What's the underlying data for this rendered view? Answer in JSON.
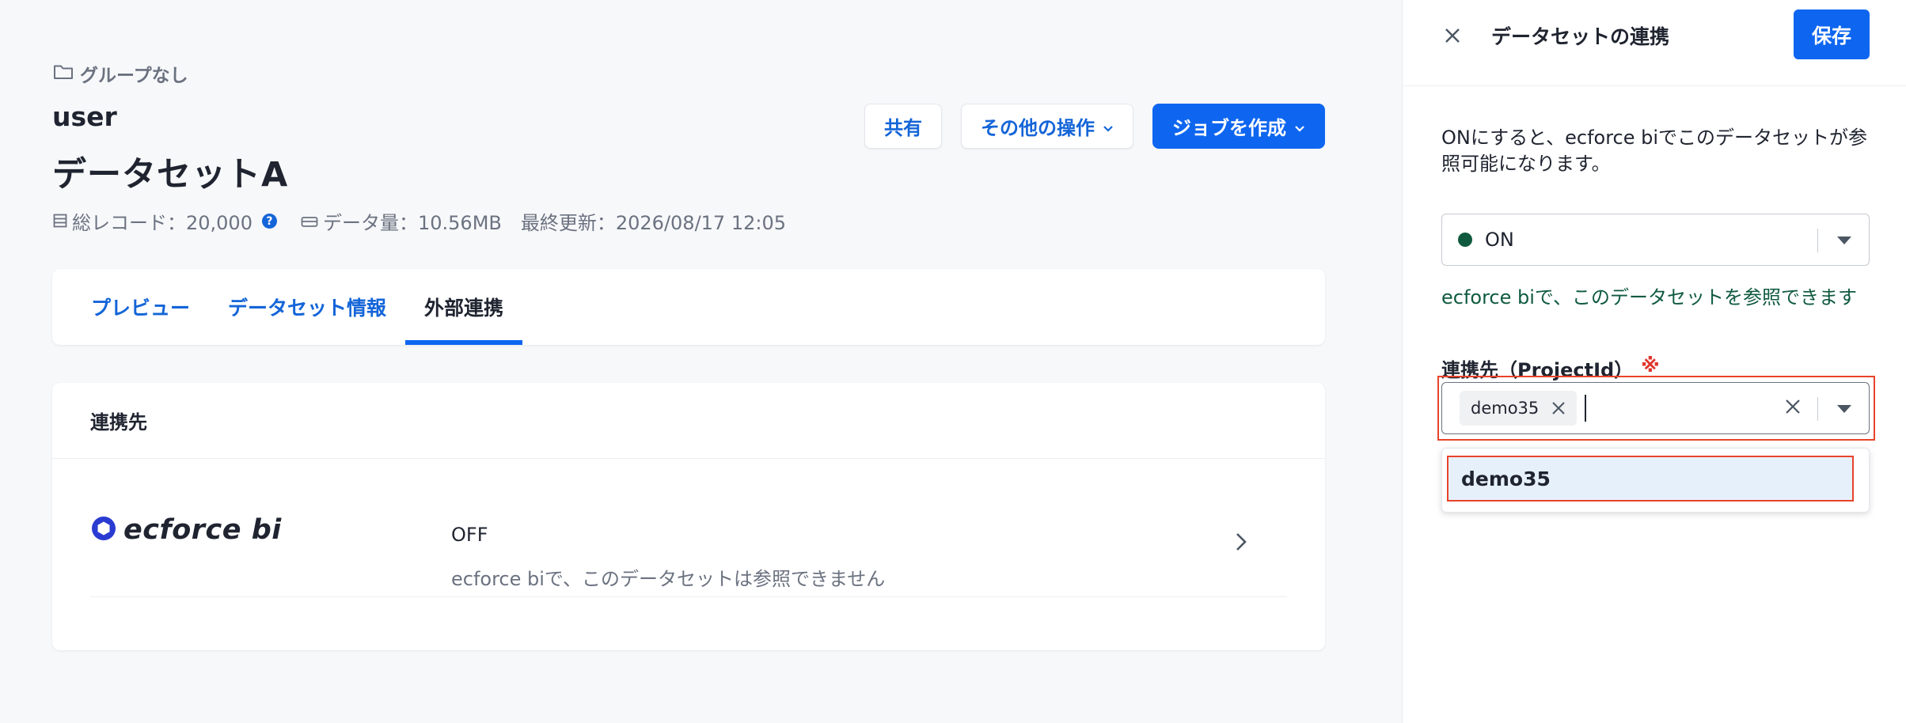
{
  "header": {
    "group_label": "グループなし",
    "owner": "user",
    "dataset_title": "データセットA",
    "total_records_label": "総レコード：20,000",
    "help_icon_glyph": "?",
    "data_size_label": "データ量：10.56MB",
    "last_updated_label": "最終更新：2026/08/17 12:05"
  },
  "actions": {
    "share_label": "共有",
    "other_actions_label": "その他の操作",
    "create_job_label": "ジョブを作成"
  },
  "tabs": [
    {
      "label": "プレビュー",
      "active": false
    },
    {
      "label": "データセット情報",
      "active": false
    },
    {
      "label": "外部連携",
      "active": true
    }
  ],
  "link_card": {
    "header": "連携先",
    "service_name": "ecforce bi",
    "status": "OFF",
    "status_description": "ecforce biで、このデータセットは参照できません"
  },
  "panel": {
    "title": "データセットの連携",
    "save_label": "保存",
    "description": "ONにすると、ecforce biでこのデータセットが参照可能になります。",
    "toggle_select_value": "ON",
    "toggle_help": "ecforce biで、このデータセットを参照できます",
    "field_label": "連携先（ProjectId）",
    "required_mark": "※",
    "selected_chip": "demo35",
    "search_value": "",
    "dropdown_option": "demo35"
  },
  "colors": {
    "primary": "#0e66f0",
    "link": "#1465d8",
    "on_status": "#0f5a3f",
    "highlight_outline": "#e8432b"
  },
  "icons": {
    "folder": "folder-icon",
    "records": "list-icon",
    "storage": "storage-icon",
    "chevron_down": "chevron-down-icon",
    "chevron_right": "chevron-right-icon",
    "close": "close-icon",
    "caret": "caret-down-icon",
    "logo": "ecforce-logo-icon"
  }
}
